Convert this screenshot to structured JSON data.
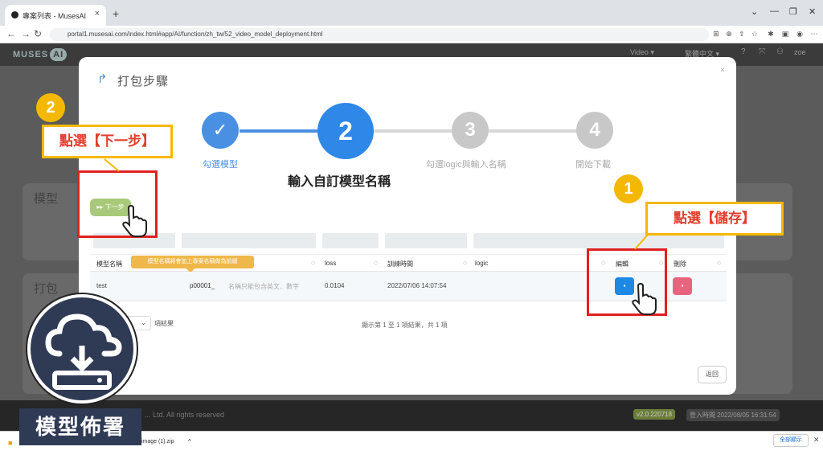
{
  "browser": {
    "tab_title": "專案列表 - MusesAI",
    "tab_close": "×",
    "new_tab": "+",
    "url": "portal1.musesai.com/index.html#app/AI/function/zh_tw/52_video_model_deployment.html"
  },
  "app": {
    "logo_text": "MUSES",
    "logo_badge": "AI",
    "header_right": [
      "Video ▾",
      "繁體中文 ▾",
      "zoe"
    ],
    "bg_card1_title": "模型",
    "bg_card2_title": "打包",
    "footer_text": "... Ltd. All rights reserved",
    "footer_version": "v2.0.220718",
    "footer_login": "登入時間 2022/08/05 16:31:54"
  },
  "download_bar": {
    "file_name": "image (1).zip",
    "show_all": "全部顯示"
  },
  "modal": {
    "title": "打包步驟",
    "steps": [
      {
        "number": "✓",
        "label": "勾選模型",
        "state": "done"
      },
      {
        "number": "2",
        "label": "輸入自訂模型名稱",
        "state": "active"
      },
      {
        "number": "3",
        "label": "勾選logic與輸入名稱",
        "state": "pending"
      },
      {
        "number": "4",
        "label": "開始下載",
        "state": "pending"
      }
    ],
    "next_button": "▸▸ 下一步",
    "back_button": "返回",
    "table": {
      "columns": [
        "模型名稱",
        "",
        "loss",
        "訓練時間",
        "logic",
        "編輯",
        "刪除"
      ],
      "rows": [
        {
          "model_name": "test",
          "custom_name_value": "p00001_",
          "custom_name_placeholder": "名稱只能包含英文、數字",
          "loss": "0.0104",
          "train_time": "2022/07/06 14:07:54",
          "logic": ""
        }
      ],
      "tooltip": "模型名稱將會加上專案名稱做為前綴"
    },
    "per_page_suffix": "項結果",
    "pagination": "顯示第 1 至 1 項結果，共 1 項"
  },
  "annotations": {
    "circle_1": "1",
    "circle_2": "2",
    "label_1": "點選【儲存】",
    "label_2": "點選【下一步】"
  },
  "badge": {
    "label": "模型佈署"
  },
  "colors": {
    "step_done": "#4a90e2",
    "step_active": "#2f88e8",
    "step_pending": "#c8c8c8",
    "annotation_yellow": "#f5b800",
    "annotation_red": "#e02020",
    "badge_navy": "#2f3a55",
    "save_blue": "#1e88e5",
    "delete_pink": "#e8637e"
  }
}
